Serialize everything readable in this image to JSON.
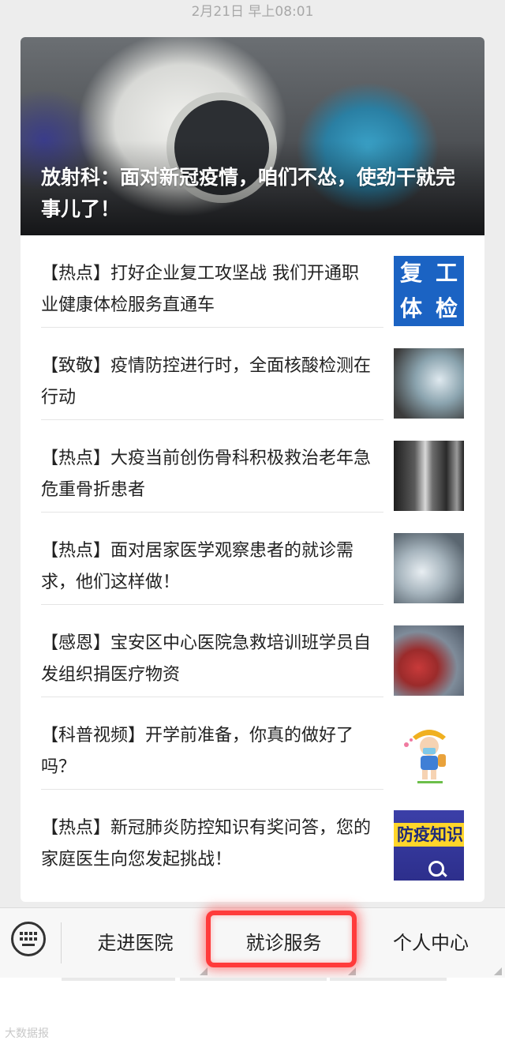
{
  "message": {
    "timestamp": "2月21日 早上08:01"
  },
  "hero": {
    "title": "放射科：面对新冠疫情，咱们不怂，使劲干就完事儿了！"
  },
  "news": [
    {
      "title": "【热点】打好企业复工攻坚战 我们开通职业健康体检服务直通车",
      "thumb_text": [
        "复",
        "工",
        "体",
        "检"
      ]
    },
    {
      "title": "【致敬】疫情防控进行时，全面核酸检测在行动"
    },
    {
      "title": "【热点】大疫当前创伤骨科积极救治老年急危重骨折患者"
    },
    {
      "title": "【热点】面对居家医学观察患者的就诊需求，他们这样做！"
    },
    {
      "title": "【感恩】宝安区中心医院急救培训班学员自发组织捐医疗物资"
    },
    {
      "title": "【科普视频】开学前准备，你真的做好了吗？"
    },
    {
      "title": "【热点】新冠肺炎防控知识有奖问答，您的家庭医生向您发起挑战！",
      "thumb_text": "防疫知识"
    }
  ],
  "bottom_menu": {
    "items": [
      {
        "label": "走进医院"
      },
      {
        "label": "就诊服务"
      },
      {
        "label": "个人中心"
      }
    ]
  },
  "watermark": "大数据报"
}
